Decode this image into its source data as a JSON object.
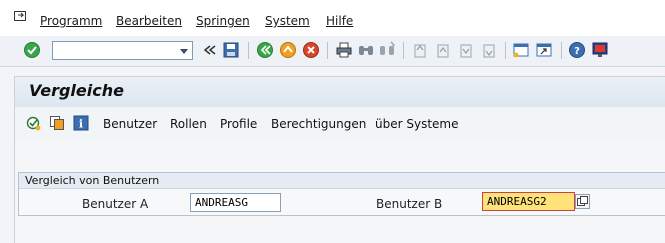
{
  "menu": {
    "items": [
      {
        "label": "Programm"
      },
      {
        "label": "Bearbeiten"
      },
      {
        "label": "Springen"
      },
      {
        "label": "System"
      },
      {
        "label": "Hilfe"
      }
    ]
  },
  "toolbar": {
    "command_field_value": "",
    "icons": [
      "enter-icon",
      "command-field-dropdown",
      "collapse-icon",
      "save-icon",
      "back-icon",
      "exit-icon",
      "cancel-icon",
      "print-icon",
      "find-icon",
      "find-next-icon",
      "first-page-icon",
      "previous-page-icon",
      "next-page-icon",
      "last-page-icon",
      "new-session-icon",
      "shortcut-icon",
      "help-icon",
      "customize-layout-icon"
    ]
  },
  "screen": {
    "title": "Vergleiche"
  },
  "app_toolbar": {
    "buttons": [
      {
        "label": "Benutzer"
      },
      {
        "label": "Rollen"
      },
      {
        "label": "Profile"
      },
      {
        "label": "Berechtigungen"
      },
      {
        "label": "über Systeme"
      }
    ]
  },
  "group": {
    "title": "Vergleich von Benutzern",
    "user_a_label": "Benutzer A",
    "user_a_value": "ANDREASG",
    "user_b_label": "Benutzer B",
    "user_b_value": "ANDREASG2"
  },
  "colors": {
    "focus_field": "#ffe27a",
    "accent_green": "#3aa64a",
    "exit_orange": "#f0a020",
    "cancel_red": "#d9452b"
  }
}
